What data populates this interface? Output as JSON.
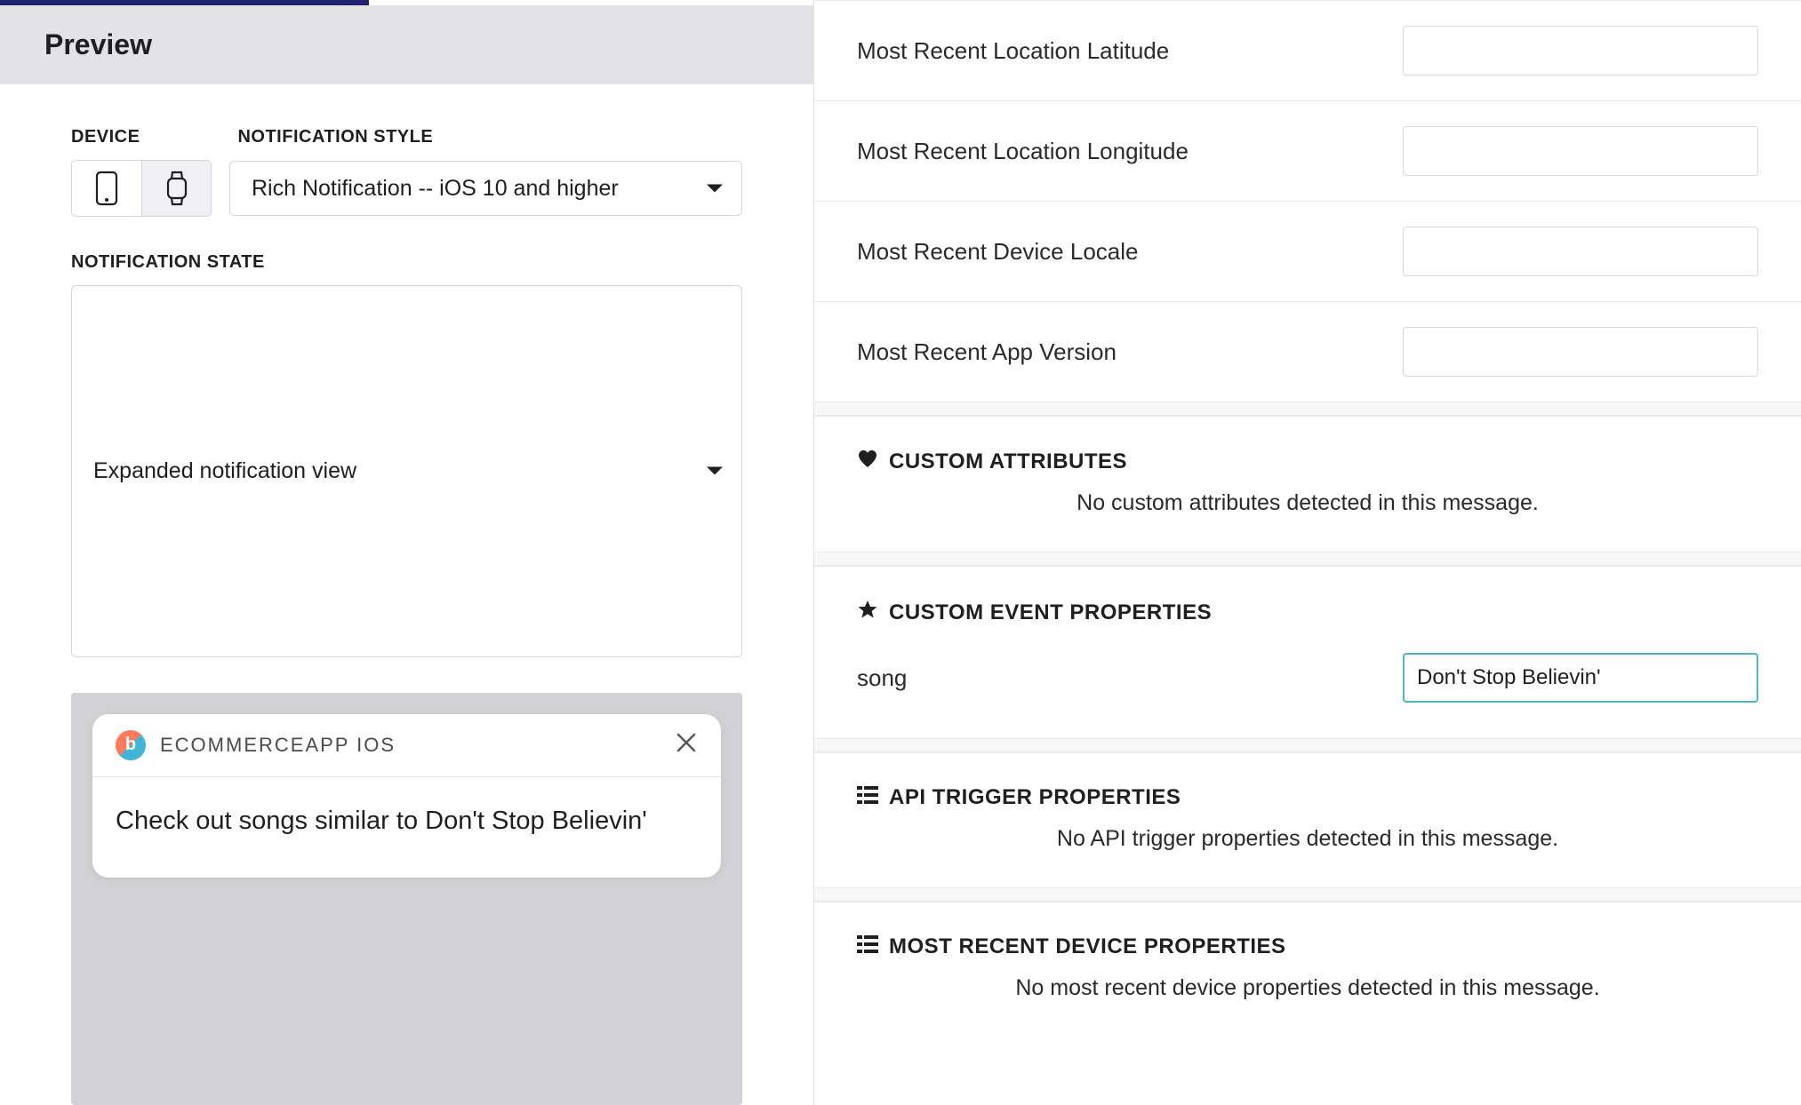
{
  "preview": {
    "title": "Preview",
    "device_label": "DEVICE",
    "style_label": "NOTIFICATION STYLE",
    "style_value": "Rich Notification -- iOS 10 and higher",
    "state_label": "NOTIFICATION STATE",
    "state_value": "Expanded notification view",
    "notification": {
      "app_name": "ECOMMERCEAPP IOS",
      "body": "Check out songs similar to Don't Stop Believin'"
    }
  },
  "right": {
    "fields": {
      "latitude": "Most Recent Location Latitude",
      "longitude": "Most Recent Location Longitude",
      "locale": "Most Recent Device Locale",
      "app_version": "Most Recent App Version"
    },
    "custom_attributes": {
      "title": "CUSTOM ATTRIBUTES",
      "empty": "No custom attributes detected in this message."
    },
    "custom_event_properties": {
      "title": "CUSTOM EVENT PROPERTIES",
      "rows": [
        {
          "key": "song",
          "value": "Don't Stop Believin'"
        }
      ]
    },
    "api_trigger": {
      "title": "API TRIGGER PROPERTIES",
      "empty": "No API trigger properties detected in this message."
    },
    "device_properties": {
      "title": "MOST RECENT DEVICE PROPERTIES",
      "empty": "No most recent device properties detected in this message."
    }
  }
}
